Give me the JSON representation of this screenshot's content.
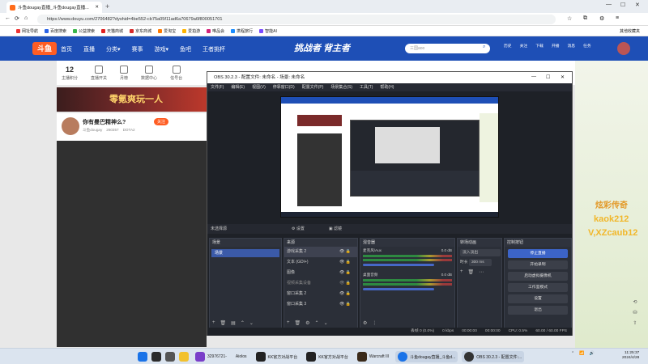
{
  "browser": {
    "tab_title": "斗鱼dougay直播_斗鱼dougay直播...",
    "url": "https://www.douyu.com/2706482?dyshid=4be552-cb75a05f11ad6a70679a6f800051701",
    "bookmarks": [
      "网址导航",
      "百度搜索",
      "公益搜索",
      "天猫商城",
      "京东商城",
      "爱淘宝",
      "爱拍游",
      "唯品会",
      "携程旅行",
      "智能AI"
    ],
    "right_label": "其他收藏夹"
  },
  "douyu": {
    "logo": "斗鱼",
    "nav": [
      "首页",
      "直播",
      "分类▾",
      "赛事",
      "游戏▾",
      "鱼吧",
      "王者挑杯"
    ],
    "banner": "挑战者 背主者",
    "search_placeholder": "三国aoo",
    "user_icons": [
      "历史",
      "关注",
      "下载",
      "开播",
      "消息",
      "任务"
    ],
    "toolbar": [
      "主播积分",
      "直播开关",
      "月榜",
      "数据中心",
      "信号台"
    ],
    "toolbar_count": "12",
    "promo_text": "零氪爽玩一人",
    "streamer_title": "你有曼巴精神么?",
    "follow_button": "关注",
    "streamer_meta": [
      "斗鱼dougay",
      "260357",
      "DOTA2"
    ],
    "right_texts": [
      "炫彩传奇",
      "kaok212",
      "V,XZcaub12"
    ]
  },
  "obs": {
    "title": "OBS 30.2.3 - 配置文件: 未命名 - 场景: 未命名",
    "menu": [
      "文件(F)",
      "编辑(E)",
      "视图(V)",
      "停靠窗口(D)",
      "配置文件(P)",
      "场景集合(S)",
      "工具(T)",
      "帮助(H)"
    ],
    "no_source": "未选择源",
    "props_btn": "设置",
    "filters_btn": "滤镜",
    "scenes_header": "场景",
    "scene_item": "场景",
    "sources_header": "来源",
    "sources": [
      "游戏采集 2",
      "文本 (GDI+)",
      "图像",
      "视频采集设备",
      "窗口采集 2",
      "窗口采集 3"
    ],
    "mixer_header": "混音器",
    "mixer_items": [
      {
        "name": "麦克风/Aux",
        "db": "0.0 dB"
      },
      {
        "name": "桌面音频",
        "db": "0.0 dB"
      }
    ],
    "transitions_header": "转场动画",
    "transition_value": "淡入淡出",
    "duration_label": "时长",
    "duration_value": "300 ms",
    "controls_header": "控制按钮",
    "controls": [
      "停止直播",
      "开始录制",
      "启动虚拟摄像机",
      "工作室模式",
      "设置",
      "退出"
    ],
    "status": [
      "丢帧 0 (0.0%)",
      "0 kbps",
      "00:00:00",
      "00:00:00",
      "CPU: 0.5%",
      "60.00 / 60.00 FPS"
    ]
  },
  "taskbar": {
    "apps": [
      "32976721-",
      "Aiolos",
      "KK官方对战平台",
      "KK官方对战平台",
      "Warcraft III",
      "斗鱼dougay直播_斗鱼d...",
      "OBS 30.2.3 - 配置文件:..."
    ],
    "time": "11:25:37",
    "date": "2024/4/28"
  },
  "colors": {
    "douyu_blue": "#1e4fb6",
    "douyu_orange": "#ff5d23",
    "obs_bg": "#1e2127",
    "obs_accent": "#3c64c8"
  }
}
